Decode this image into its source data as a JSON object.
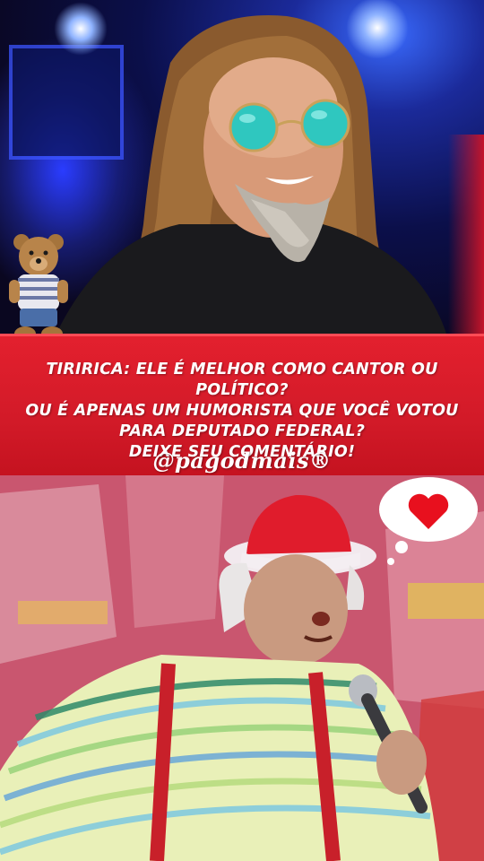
{
  "caption": {
    "line1": "TIRIRICA: ELE É MELHOR COMO CANTOR OU POLÍTICO?",
    "line2": "OU É APENAS UM HUMORISTA QUE VOCÊ VOTOU",
    "line3": "PARA DEPUTADO FEDERAL?",
    "line4": "DEIXE SEU COMENTÁRIO!"
  },
  "handle": "@pagodmais®",
  "icons": {
    "heart": "heart-icon",
    "bubble": "thought-bubble-icon",
    "bear": "teddy-bear-sticker"
  },
  "colors": {
    "band": "#d21a28",
    "heart": "#e8101e",
    "text": "#ffffff"
  }
}
